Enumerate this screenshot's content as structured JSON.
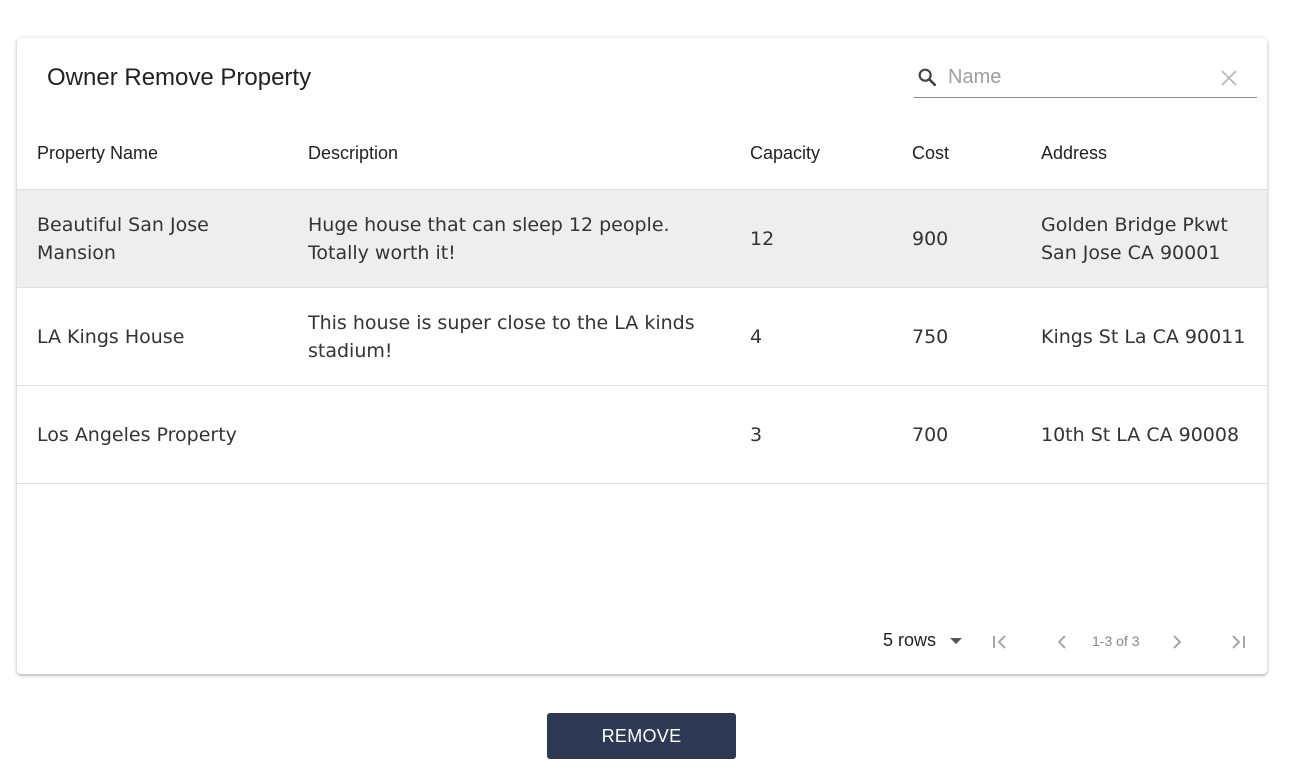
{
  "title": "Owner Remove Property",
  "search": {
    "placeholder": "Name",
    "value": "",
    "icon": "search-icon",
    "clear_icon": "close-icon"
  },
  "table": {
    "columns": [
      "Property Name",
      "Description",
      "Capacity",
      "Cost",
      "Address"
    ],
    "rows": [
      {
        "name": "Beautiful San Jose Mansion",
        "description": "Huge house that can sleep 12 people. Totally worth it!",
        "capacity": "12",
        "cost": "900",
        "address": "Golden Bridge Pkwt San Jose CA 90001",
        "selected": true
      },
      {
        "name": "LA Kings House",
        "description": "This house is super close to the LA kinds stadium!",
        "capacity": "4",
        "cost": "750",
        "address": "Kings St La CA 90011",
        "selected": false
      },
      {
        "name": "Los Angeles Property",
        "description": "",
        "capacity": "3",
        "cost": "700",
        "address": "10th St LA CA 90008",
        "selected": false
      }
    ]
  },
  "pagination": {
    "rows_per_page": "5 rows",
    "page_info": "1-3 of 3",
    "icons": [
      "first-page-icon",
      "previous-page-icon",
      "next-page-icon",
      "last-page-icon"
    ]
  },
  "actions": {
    "remove_label": "REMOVE"
  },
  "colors": {
    "selected_row": "#eeeeee",
    "button_bg": "#2e3a55",
    "button_text": "#ffffff"
  }
}
